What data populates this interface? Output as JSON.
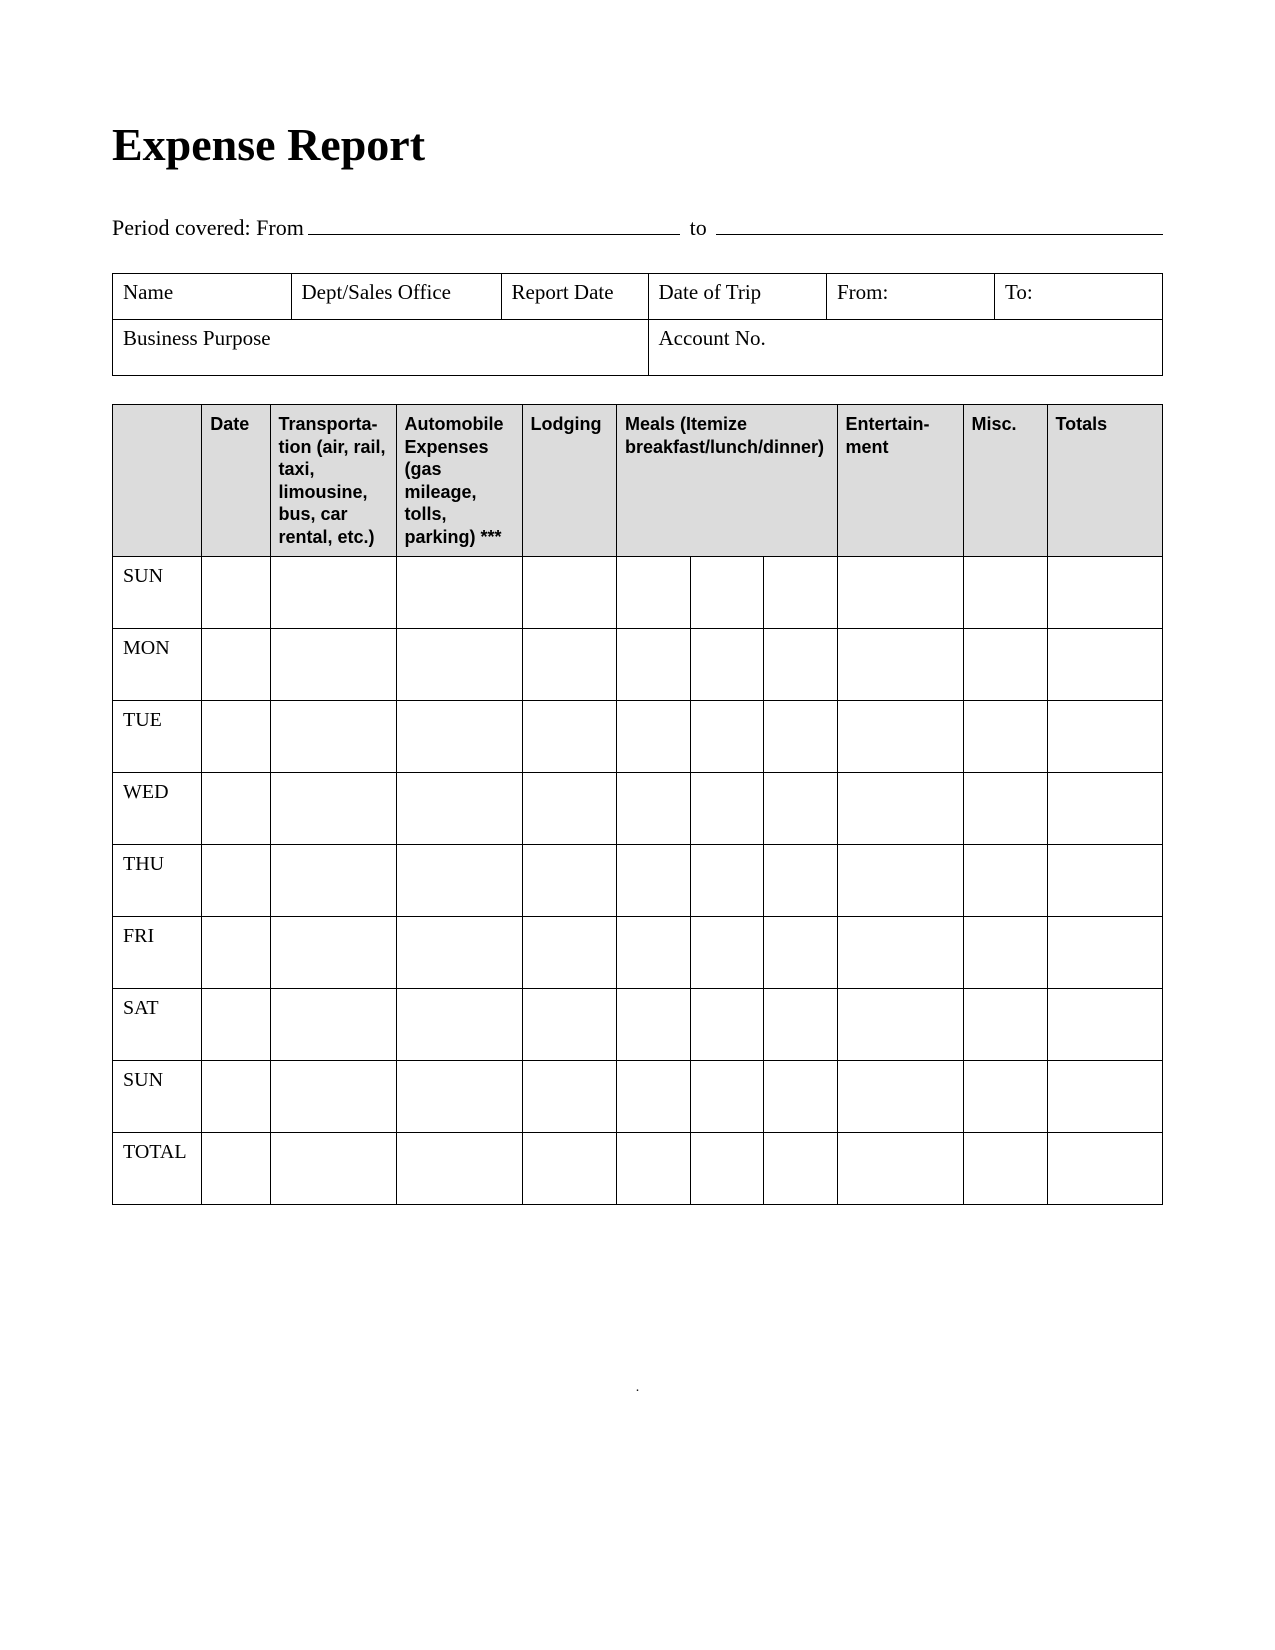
{
  "title": "Expense Report",
  "period": {
    "label_from": "Period covered: From",
    "label_to": "to"
  },
  "info_table": {
    "row1": {
      "name": "Name",
      "dept": "Dept/Sales Office",
      "report_date": "Report Date",
      "date_of_trip": "Date of Trip",
      "from": "From:",
      "to": "To:"
    },
    "row2": {
      "business_purpose": "Business Purpose",
      "account_no": "Account No."
    }
  },
  "expense_headers": {
    "blank": "",
    "date": "Date",
    "transportation": "Transporta-\ntion (air, rail, taxi, limousine, bus, car rental, etc.)",
    "automobile": "Automobile Expenses (gas mileage, tolls, parking) ***",
    "lodging": "Lodging",
    "meals": "Meals (Itemize breakfast/lunch/dinner)",
    "entertainment": "Entertain-\nment",
    "misc": "Misc.",
    "totals": "Totals"
  },
  "days": [
    "SUN",
    "MON",
    "TUE",
    "WED",
    "THU",
    "FRI",
    "SAT",
    "SUN",
    "TOTAL"
  ],
  "footer_dot": "."
}
